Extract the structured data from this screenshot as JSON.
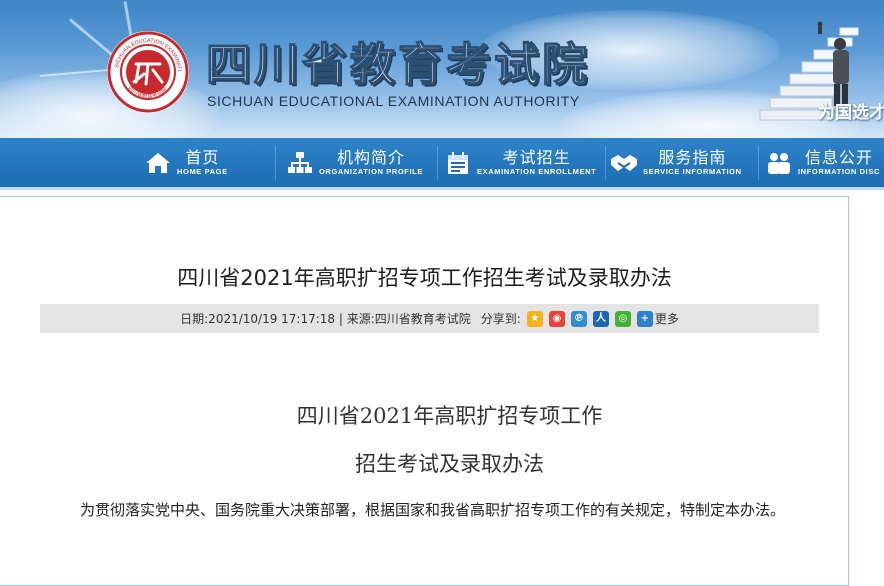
{
  "header": {
    "title_cn": "四川省教育考试院",
    "title_en": "SICHUAN EDUCATIONAL EXAMINATION AUTHORITY",
    "slogan": "为国选才",
    "colors": {
      "banner_top": "#3d85c6",
      "nav_bg": "#1e6db3",
      "logo_red": "#c8282e"
    }
  },
  "nav": {
    "items": [
      {
        "cn": "首页",
        "en": "HOME PAGE",
        "icon": "home-icon"
      },
      {
        "cn": "机构简介",
        "en": "ORGANIZATION PROFILE",
        "icon": "org-chart-icon"
      },
      {
        "cn": "考试招生",
        "en": "EXAMINATION ENROLLMENT",
        "icon": "calendar-icon"
      },
      {
        "cn": "服务指南",
        "en": "SERVICE INFORMATION",
        "icon": "handshake-icon"
      },
      {
        "cn": "信息公开",
        "en": "INFORMATION DISC",
        "icon": "people-icon"
      }
    ]
  },
  "article": {
    "title": "四川省2021年高职扩招专项工作招生考试及录取办法",
    "meta": "日期:2021/10/19 17:17:18 | 来源:四川省教育考试院",
    "share_label": "分享到:",
    "share_more": "更多",
    "share_icons": [
      "qzone-icon",
      "weibo-icon",
      "tencent-weibo-icon",
      "renren-icon",
      "wechat-icon",
      "plus-icon"
    ],
    "doc_title_line1": "四川省2021年高职扩招专项工作",
    "doc_title_line2": "招生考试及录取办法",
    "paragraph": "为贯彻落实党中央、国务院重大决策部署，根据国家和我省高职扩招专项工作的有关规定，特制定本办法。"
  }
}
